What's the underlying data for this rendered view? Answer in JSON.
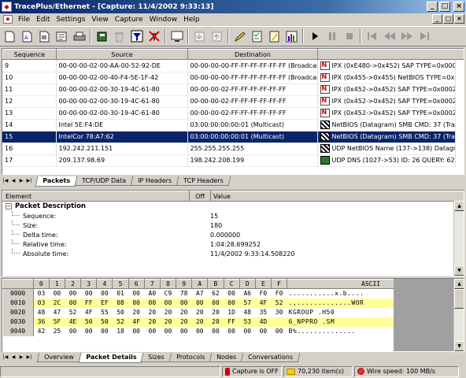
{
  "window": {
    "title": "TracePlus/Ethernet - [Capture: 11/4/2002 9:33:13]",
    "controls": [
      "_",
      "□",
      "×"
    ]
  },
  "menu": [
    "File",
    "Edit",
    "Settings",
    "View",
    "Capture",
    "Window",
    "Help"
  ],
  "toolbar_icons": [
    "new-icon",
    "open-icon",
    "save-icon",
    "properties-icon",
    "print-icon",
    "book-icon",
    "delete-icon",
    "capture-filter-icon",
    "no-filter-icon",
    "display-icon",
    "import-icon",
    "export-icon",
    "pencil-icon",
    "checklist-icon",
    "note-icon",
    "stats-icon",
    "play-icon",
    "pause-icon",
    "stop-icon",
    "first-icon",
    "prev-icon",
    "next-icon",
    "last-icon"
  ],
  "packets": {
    "columns": [
      "Sequence",
      "Source",
      "Destination",
      ""
    ],
    "rows": [
      {
        "seq": "9",
        "src": "00-00-00-02-00-AA-00-52-92-DE",
        "dst": "00-00-00-00-FF-FF-FF-FF-FF-FF (Broadcast)",
        "icon": "net",
        "sum": "IPX (0xE480->0x452)  SAP TYPE=0x0002"
      },
      {
        "seq": "10",
        "src": "00-00-00-02-00-40-F4-5E-1F-42",
        "dst": "00-00-00-00-FF-FF-FF-FF-FF-FF (Broadcast)",
        "icon": "net",
        "sum": "IPX (0x455->0x455)  NetBIOS TYPE=0x01"
      },
      {
        "seq": "11",
        "src": "00-00-00-02-00-30-19-4C-61-80",
        "dst": "00-00-00-02-FF-FF-FF-FF-FF-FF",
        "icon": "net",
        "sum": "IPX (0x452->0x452)  SAP TYPE=0x0002 (I"
      },
      {
        "seq": "12",
        "src": "00-00-00-02-00-30-19-4C-61-80",
        "dst": "00-00-00-02-FF-FF-FF-FF-FF-FF",
        "icon": "net",
        "sum": "IPX (0x452->0x452)  SAP TYPE=0x0002 (I"
      },
      {
        "seq": "13",
        "src": "00-00-00-02-00-30-19-4C-61-80",
        "dst": "00-00-00-02-FF-FF-FF-FF-FF-FF",
        "icon": "net",
        "sum": "IPX (0x452->0x452)  SAP TYPE=0x0002 (I"
      },
      {
        "seq": "14",
        "src": "Intel 5E:F4:DE",
        "dst": "03:00:00:00:00:01 (Multicast)",
        "icon": "dg",
        "sum": "NetBIOS (Datagram)  SMB CMD: 37 (Trans"
      },
      {
        "seq": "15",
        "src": "IntelCor 78:A7:62",
        "dst": "03:00:00:00:00:01 (Multicast)",
        "icon": "dg",
        "sum": "NetBIOS (Datagram)  SMB CMD: 37 (Trans"
      },
      {
        "seq": "16",
        "src": "192.242.211.151",
        "dst": "255.255.255.255",
        "icon": "dg",
        "sum": "UDP NetBIOS Name (137->138) Datagram"
      },
      {
        "seq": "17",
        "src": "209.137.98.69",
        "dst": "198.242.208.199",
        "icon": "udp",
        "sum": "UDP DNS (1027->53)  ID: 26  QUERY: 62.2"
      }
    ]
  },
  "top_tabs": [
    "Packets",
    "TCP/UDP Data",
    "IP Headers",
    "TCP Headers"
  ],
  "details": {
    "columns": [
      "Element",
      "Off",
      "Value"
    ],
    "group": "Packet Description",
    "rows": [
      {
        "label": "Sequence:",
        "value": "15"
      },
      {
        "label": "Size:",
        "value": "180"
      },
      {
        "label": "Delta time:",
        "value": "0.000000"
      },
      {
        "label": "Relative time:",
        "value": "1:04:28.699252"
      },
      {
        "label": "Absolute time:",
        "value": "11/4/2002 9:33:14.508220"
      }
    ]
  },
  "hex": {
    "columns": [
      "0",
      "1",
      "2",
      "3",
      "4",
      "5",
      "6",
      "7",
      "8",
      "9",
      "A",
      "B",
      "C",
      "D",
      "E",
      "F"
    ],
    "ascii_header": "ASCII",
    "rows": [
      {
        "off": "0000",
        "bytes": [
          "03",
          "00",
          "00",
          "00",
          "00",
          "01",
          "00",
          "A0",
          "C9",
          "78",
          "A7",
          "62",
          "00",
          "A6",
          "F0",
          "F0"
        ],
        "ascii": "...........x.b....",
        "hl": false
      },
      {
        "off": "0010",
        "bytes": [
          "03",
          "2C",
          "00",
          "FF",
          "EF",
          "08",
          "00",
          "00",
          "00",
          "00",
          "00",
          "00",
          "00",
          "57",
          "4F",
          "52"
        ],
        "ascii": ".,.............WOR",
        "hl": true
      },
      {
        "off": "0020",
        "bytes": [
          "48",
          "47",
          "52",
          "4F",
          "55",
          "50",
          "20",
          "20",
          "20",
          "20",
          "20",
          "20",
          "1D",
          "48",
          "35",
          "30"
        ],
        "ascii": "KGROUP       .H50",
        "hl": false
      },
      {
        "off": "0030",
        "bytes": [
          "36",
          "5F",
          "4E",
          "50",
          "50",
          "52",
          "4F",
          "20",
          "20",
          "20",
          "20",
          "20",
          "FF",
          "53",
          "4D"
        ],
        "ascii": "6_NPPRO      .SM",
        "hl": true
      },
      {
        "off": "0040",
        "bytes": [
          "42",
          "25",
          "00",
          "00",
          "00",
          "18",
          "00",
          "00",
          "00",
          "00",
          "00",
          "00",
          "00",
          "00",
          "00",
          "00"
        ],
        "ascii": "B%..............",
        "hl": false
      }
    ]
  },
  "bottom_tabs": [
    "Overview",
    "Packet Details",
    "Sizes",
    "Protocols",
    "Nodes",
    "Conversations"
  ],
  "status": {
    "capture": "Capture is OFF",
    "items": "70,230 item(s)",
    "speed": "Wire speed: 100 MB/s"
  },
  "colors": {
    "title": "#0a246a",
    "selection": "#0a246a",
    "hex_highlight": "#ffff99"
  }
}
